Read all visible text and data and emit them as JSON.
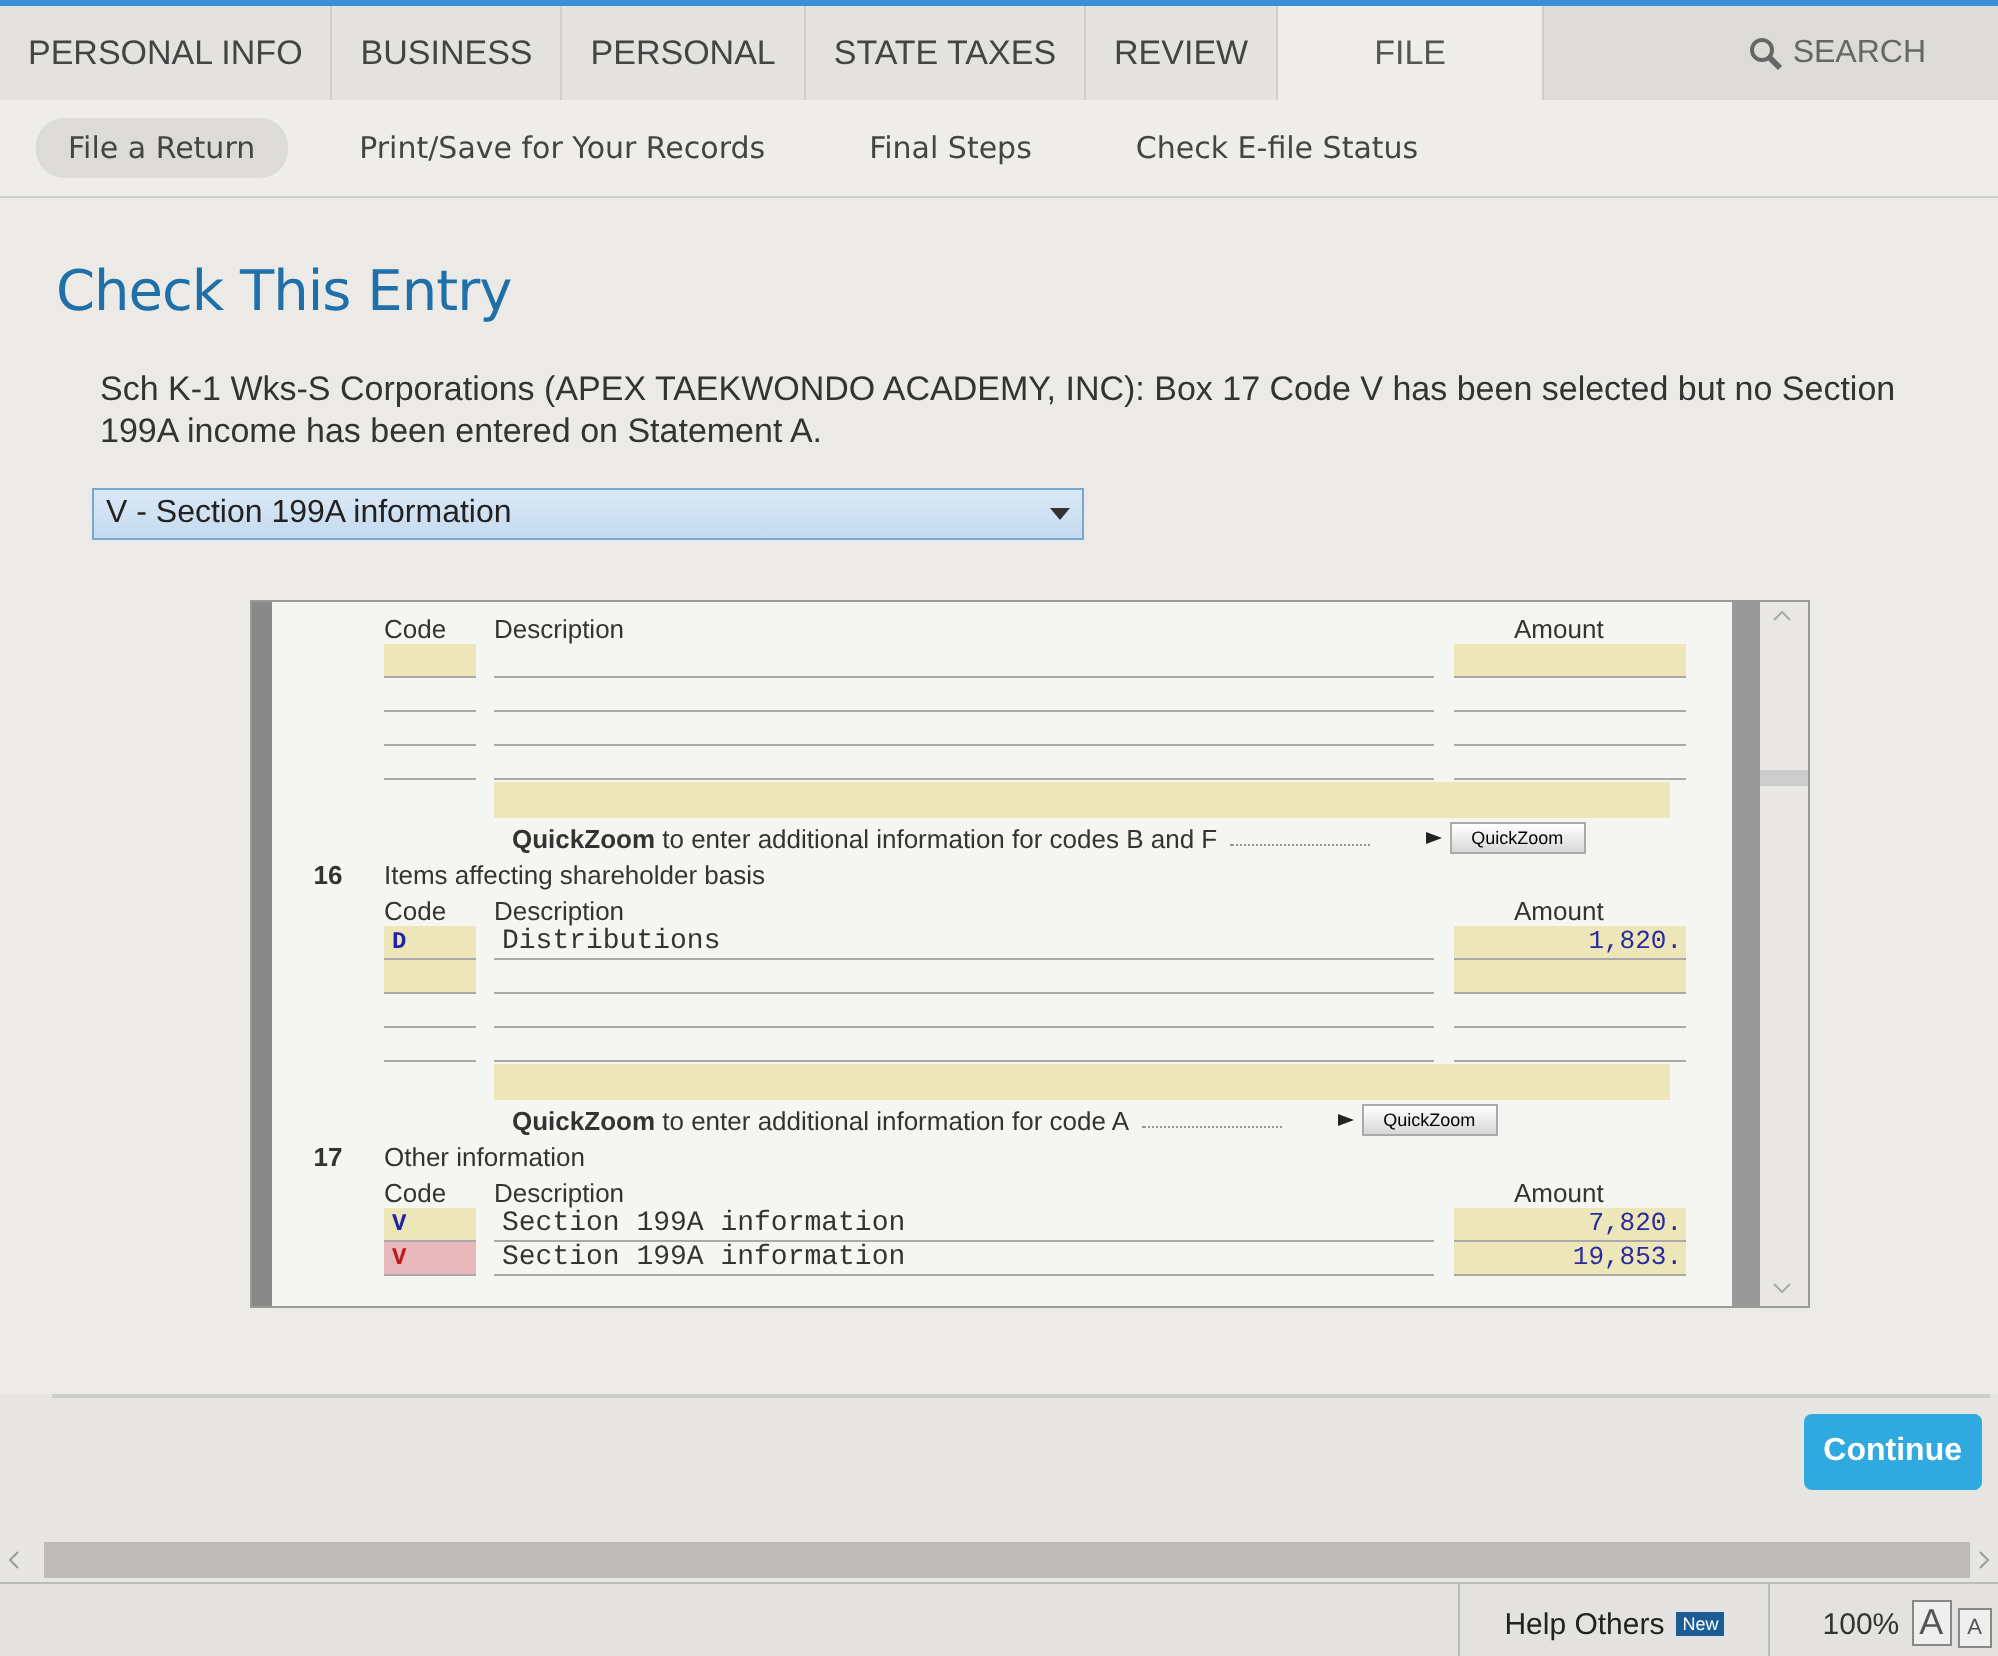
{
  "tabs": [
    {
      "label": "PERSONAL INFO",
      "selected": false
    },
    {
      "label": "BUSINESS",
      "selected": false
    },
    {
      "label": "PERSONAL",
      "selected": false
    },
    {
      "label": "STATE TAXES",
      "selected": false
    },
    {
      "label": "REVIEW",
      "selected": false
    },
    {
      "label": "FILE",
      "selected": true
    }
  ],
  "search": {
    "label": "SEARCH"
  },
  "subtabs": [
    {
      "label": "File a Return",
      "selected": true
    },
    {
      "label": "Print/Save for Your Records",
      "selected": false
    },
    {
      "label": "Final Steps",
      "selected": false
    },
    {
      "label": "Check E-file Status",
      "selected": false
    }
  ],
  "heading": "Check This Entry",
  "message": "Sch K-1 Wks-S Corporations (APEX TAEKWONDO ACADEMY, INC): Box 17 Code V has been selected but no Section 199A income has been entered on Statement A.",
  "dropdown": {
    "value": "V - Section 199A information"
  },
  "form": {
    "sections": [
      {
        "headers": [
          "Code",
          "Description",
          "Amount"
        ],
        "rows": [
          {
            "code": "",
            "description": "",
            "amount": "",
            "highlighted": true,
            "error": false
          },
          {
            "code": "",
            "description": "",
            "amount": "",
            "highlighted": false,
            "error": false
          },
          {
            "code": "",
            "description": "",
            "amount": "",
            "highlighted": false,
            "error": false
          },
          {
            "code": "",
            "description": "",
            "amount": "",
            "highlighted": false,
            "error": false
          }
        ],
        "note": "**QuickZoom** to enter additional information for codes B and F",
        "button": "QuickZoom"
      },
      {
        "number": "16",
        "title": "Items affecting shareholder basis",
        "headers": [
          "Code",
          "Description",
          "Amount"
        ],
        "rows": [
          {
            "code": "D",
            "description": "Distributions",
            "amount": "1,820.",
            "highlighted": true,
            "error": false
          },
          {
            "code": "",
            "description": "",
            "amount": "",
            "highlighted": true,
            "error": false
          },
          {
            "code": "",
            "description": "",
            "amount": "",
            "highlighted": false,
            "error": false
          },
          {
            "code": "",
            "description": "",
            "amount": "",
            "highlighted": false,
            "error": false
          }
        ],
        "note": "**QuickZoom** to enter additional information for code A",
        "button": "QuickZoom"
      },
      {
        "number": "17",
        "title": "Other information",
        "headers": [
          "Code",
          "Description",
          "Amount"
        ],
        "rows": [
          {
            "code": "V",
            "description": "Section 199A information",
            "amount": "7,820.",
            "highlighted": true,
            "error": false
          },
          {
            "code": "V",
            "description": "Section 199A information",
            "amount": "19,853.",
            "highlighted": true,
            "error": true
          }
        ]
      }
    ]
  },
  "continue_button": "Continue",
  "status_bar": {
    "help": "Help Others",
    "badge": "New",
    "zoom": "100%",
    "font_buttons": [
      "A",
      "A"
    ]
  }
}
